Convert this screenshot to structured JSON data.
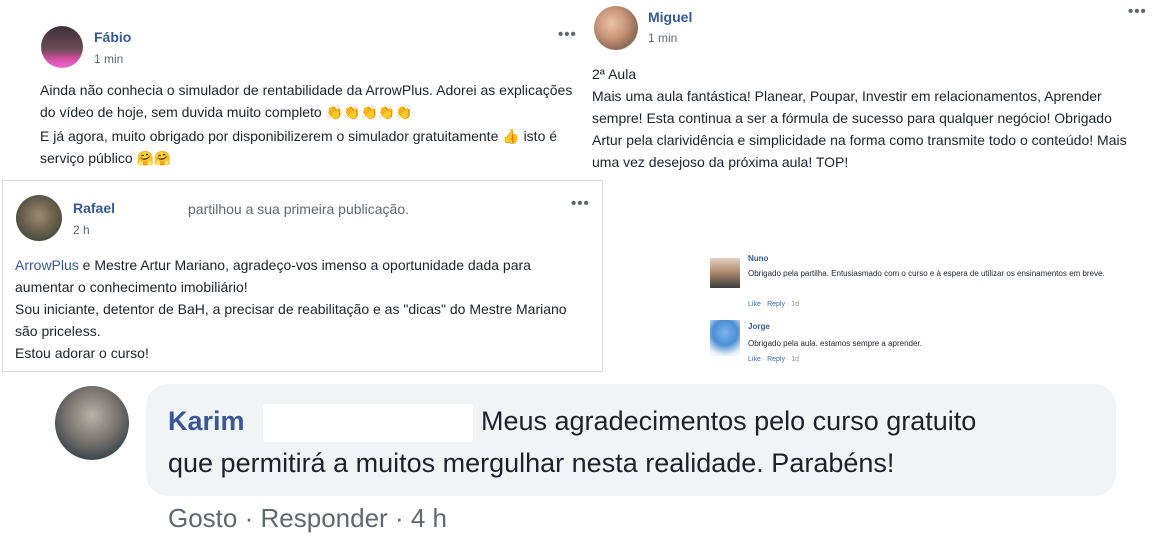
{
  "post_fabio": {
    "name": "Fábio",
    "time": "1 min",
    "more": "•••",
    "para1": "Ainda não conhecia o simulador de rentabilidade da ArrowPlus. Adorei as explicações do vídeo de hoje, sem duvida muito completo 👏👏👏👏👏",
    "para2": "E já agora, muito obrigado por disponibilizerem o simulador gratuitamente 👍 isto é serviço público 🤗🤗"
  },
  "post_miguel": {
    "name": "Miguel",
    "time": "1 min",
    "more": "•••",
    "heading": "2ª Aula",
    "body": "Mais uma aula fantástica! Planear, Poupar, Investir em relacionamentos, Aprender sempre! Esta continua a ser a fórmula de sucesso para qualquer negócio! Obrigado Artur pela clarividência e simplicidade na forma como transmite todo o conteúdo! Mais uma vez desejoso da próxima aula! TOP!"
  },
  "post_rafael": {
    "name": "Rafael",
    "action": "partilhou a sua primeira publicação.",
    "time": "2 h",
    "more": "•••",
    "mention": "ArrowPlus",
    "line1_rest": " e Mestre Artur Mariano, agradeço-vos imenso a oportunidade dada para aumentar o conhecimento imobiliário!",
    "line2": "Sou iniciante, detentor de BaH, a precisar de reabilitação e as \"dicas\" do Mestre Mariano são priceless.",
    "line3": "Estou adorar o curso!"
  },
  "mini_comments": [
    {
      "name": "Nuno",
      "text": "Obrigado pela partilha. Entusiasmado com o curso e à espera de utilizar os ensinamentos em breve.",
      "like": "Like",
      "reply": "Reply",
      "time": "1d"
    },
    {
      "name": "Jorge",
      "text": "Obrigado pela aula. estamos sempre a aprender.",
      "like": "Like",
      "reply": "Reply",
      "time": "1d"
    }
  ],
  "big_comment": {
    "name": "Karim",
    "line1": "Meus agradecimentos pelo curso gratuito",
    "line2": "que permitirá a muitos mergulhar nesta realidade. Parabéns!",
    "like": "Gosto",
    "reply": "Responder",
    "time": "4 h",
    "separator": "·"
  },
  "colors": {
    "link": "#365899",
    "bubble": "#f2f3f5",
    "meta": "#606770"
  }
}
